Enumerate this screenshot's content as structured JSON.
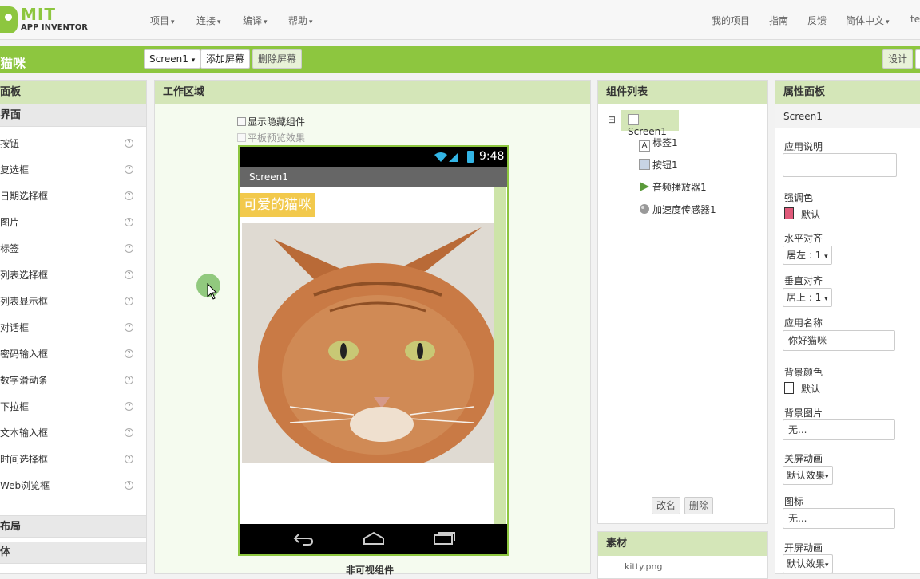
{
  "header": {
    "logo_mit": "MIT",
    "logo_app": "APP INVENTOR",
    "menus": [
      "项目",
      "连接",
      "编译",
      "帮助"
    ],
    "right_links": [
      "我的项目",
      "指南",
      "反馈",
      "简体中文",
      "te"
    ]
  },
  "toolbar": {
    "project_name": "猫咪",
    "screen_select": "Screen1",
    "add_screen": "添加屏幕",
    "remove_screen": "删除屏幕",
    "design_button": "设计"
  },
  "palette": {
    "title": "面板",
    "category_user_interface": "界面",
    "items": [
      "按钮",
      "复选框",
      "日期选择框",
      "图片",
      "标签",
      "列表选择框",
      "列表显示框",
      "对话框",
      "密码输入框",
      "数字滑动条",
      "下拉框",
      "文本输入框",
      "时间选择框",
      "Web浏览框"
    ],
    "category_layout": "布局",
    "category_media": "体"
  },
  "viewer": {
    "title": "工作区域",
    "show_hidden": "显示隐藏组件",
    "tablet_preview": "平板预览效果",
    "status_time": "9:48",
    "screen_title": "Screen1",
    "label_text": "可爱的猫咪",
    "non_visible": "非可视组件"
  },
  "components": {
    "title": "组件列表",
    "tree": [
      "Screen1",
      "标签1",
      "按钮1",
      "音频播放器1",
      "加速度传感器1"
    ],
    "rename": "改名",
    "delete": "删除",
    "media_title": "素材",
    "media_file": "kitty.png"
  },
  "properties": {
    "title": "属性面板",
    "component": "Screen1",
    "about_label": "应用说明",
    "accent_label": "强调色",
    "accent_value": "默认",
    "accent_color": "#e05a7a",
    "align_h_label": "水平对齐",
    "align_h_value": "居左 : 1",
    "align_v_label": "垂直对齐",
    "align_v_value": "居上 : 1",
    "app_name_label": "应用名称",
    "app_name_value": "你好猫咪",
    "bg_color_label": "背景颜色",
    "bg_color_value": "默认",
    "bg_image_label": "背景图片",
    "bg_image_value": "无...",
    "close_anim_label": "关屏动画",
    "close_anim_value": "默认效果",
    "icon_label": "图标",
    "icon_value": "无...",
    "open_anim_label": "开屏动画",
    "open_anim_value": "默认效果"
  }
}
